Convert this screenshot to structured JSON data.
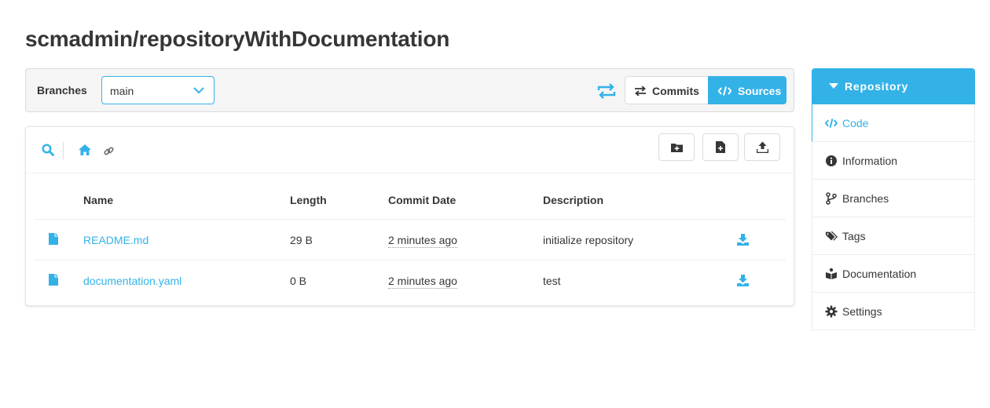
{
  "page": {
    "title": "scmadmin/repositoryWithDocumentation"
  },
  "branch_bar": {
    "label": "Branches",
    "selected": "main",
    "commits_label": "Commits",
    "sources_label": "Sources"
  },
  "file_table": {
    "columns": [
      "Name",
      "Length",
      "Commit Date",
      "Description"
    ],
    "rows": [
      {
        "name": "README.md",
        "length": "29 B",
        "date": "2 minutes ago",
        "description": "initialize repository"
      },
      {
        "name": "documentation.yaml",
        "length": "0 B",
        "date": "2 minutes ago",
        "description": "test"
      }
    ]
  },
  "sidebar": {
    "header": "Repository",
    "items": [
      {
        "label": "Code",
        "icon": "code-icon",
        "active": true
      },
      {
        "label": "Information",
        "icon": "info-icon"
      },
      {
        "label": "Branches",
        "icon": "branch-icon"
      },
      {
        "label": "Tags",
        "icon": "tags-icon"
      },
      {
        "label": "Documentation",
        "icon": "book-icon"
      },
      {
        "label": "Settings",
        "icon": "gear-icon"
      }
    ]
  },
  "colors": {
    "accent": "#33b2e8",
    "text": "#363636",
    "border": "#dbdbdb"
  }
}
